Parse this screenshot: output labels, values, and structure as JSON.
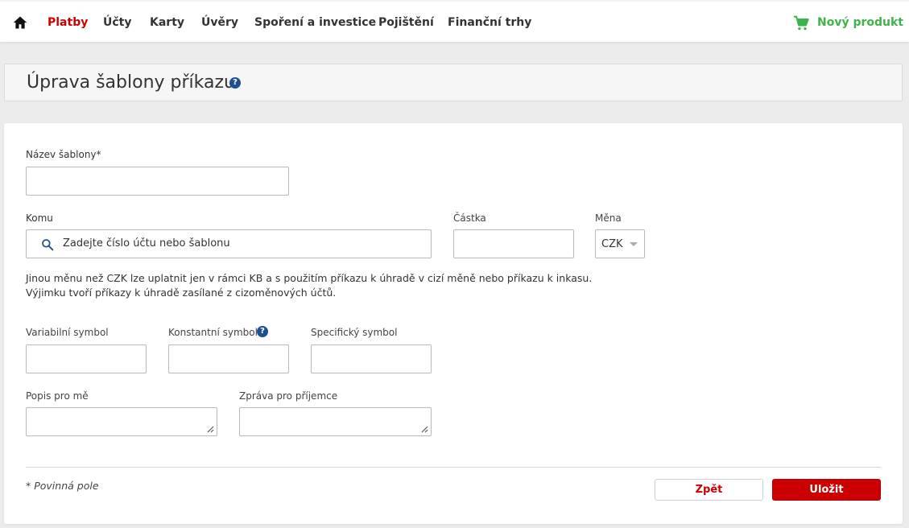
{
  "nav": {
    "items": [
      "Platby",
      "Účty",
      "Karty",
      "Úvěry",
      "Spoření a investice",
      "Pojištění",
      "Finanční trhy"
    ],
    "active_index": 0,
    "new_product": "Nový produkt",
    "accent_color": "#cc0000",
    "green_color": "#3cb44b"
  },
  "header": {
    "title": "Úprava šablony příkazu",
    "help_glyph": "?"
  },
  "form": {
    "template_name_label": "Název šablony*",
    "template_name_value": "",
    "to_label": "Komu",
    "to_placeholder": "Zadejte číslo účtu nebo šablonu",
    "amount_label": "Částka",
    "amount_value": "",
    "currency_label": "Měna",
    "currency_value": "CZK",
    "info_line1": "Jinou měnu než CZK lze uplatnit jen v rámci KB a s použitím příkazu k úhradě v cizí měně nebo příkazu k inkasu.",
    "info_line2": "Výjimku tvoří příkazy k úhradě zasílané z cizoměnových účtů.",
    "variable_symbol_label": "Variabilní symbol",
    "constant_symbol_label": "Konstantní symbol",
    "specific_symbol_label": "Specifický symbol",
    "note_for_me_label": "Popis pro mě",
    "message_for_recipient_label": "Zpráva pro příjemce",
    "required_note": "* Povinná pole"
  },
  "buttons": {
    "back": "Zpět",
    "save": "Uložit"
  }
}
